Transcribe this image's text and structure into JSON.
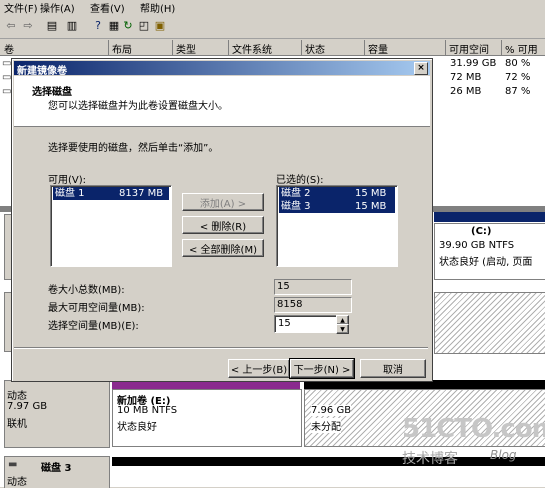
{
  "menu": [
    "文件(F)",
    "操作(A)",
    "查看(V)",
    "帮助(H)"
  ],
  "columns": [
    "卷",
    "布局",
    "类型",
    "文件系统",
    "状态",
    "容量",
    "可用空间",
    "% 可用"
  ],
  "volume_rows": [
    {
      "free": "31.99 GB",
      "pct": "80 %"
    },
    {
      "free": "72 MB",
      "pct": "72 %"
    },
    {
      "free": "26 MB",
      "pct": "87 %"
    }
  ],
  "disk_c": {
    "name": "(C:)",
    "size_fs": "39.90 GB NTFS",
    "status": "状态良好 (启动, 页面"
  },
  "disk2_left": {
    "type": "动态",
    "size": "7.97 GB",
    "state": "联机"
  },
  "disk2_vol": {
    "name": "新加卷  (E:)",
    "size_fs": "10 MB NTFS",
    "status": "状态良好"
  },
  "disk2_unalloc": {
    "size": "7.96 GB",
    "status": "未分配"
  },
  "disk3": {
    "title": "磁盘 3",
    "type": "动态"
  },
  "watermark": {
    "main": "51CTO.com",
    "sub": "技术博客",
    "blog": "Blog"
  },
  "dialog": {
    "title": "新建镜像卷",
    "close": "×",
    "header_title": "选择磁盘",
    "header_sub": "您可以选择磁盘并为此卷设置磁盘大小。",
    "instruction": "选择要使用的磁盘，然后单击“添加”。",
    "available_label": "可用(V):",
    "available": [
      {
        "disk": "磁盘 1",
        "size": "8137 MB"
      }
    ],
    "selected_label": "已选的(S):",
    "selected": [
      {
        "disk": "磁盘 2",
        "size": "15 MB"
      },
      {
        "disk": "磁盘 3",
        "size": "15 MB"
      }
    ],
    "btn_add": "添加(A) >",
    "btn_remove": "< 删除(R)",
    "btn_remove_all": "< 全部删除(M)",
    "total_label": "卷大小总数(MB):",
    "total_value": "15",
    "max_label": "最大可用空间量(MB):",
    "max_value": "8158",
    "alloc_label": "选择空间量(MB)(E):",
    "alloc_value": "15",
    "btn_back": "< 上一步(B)",
    "btn_next": "下一步(N) >",
    "btn_cancel": "取消"
  }
}
